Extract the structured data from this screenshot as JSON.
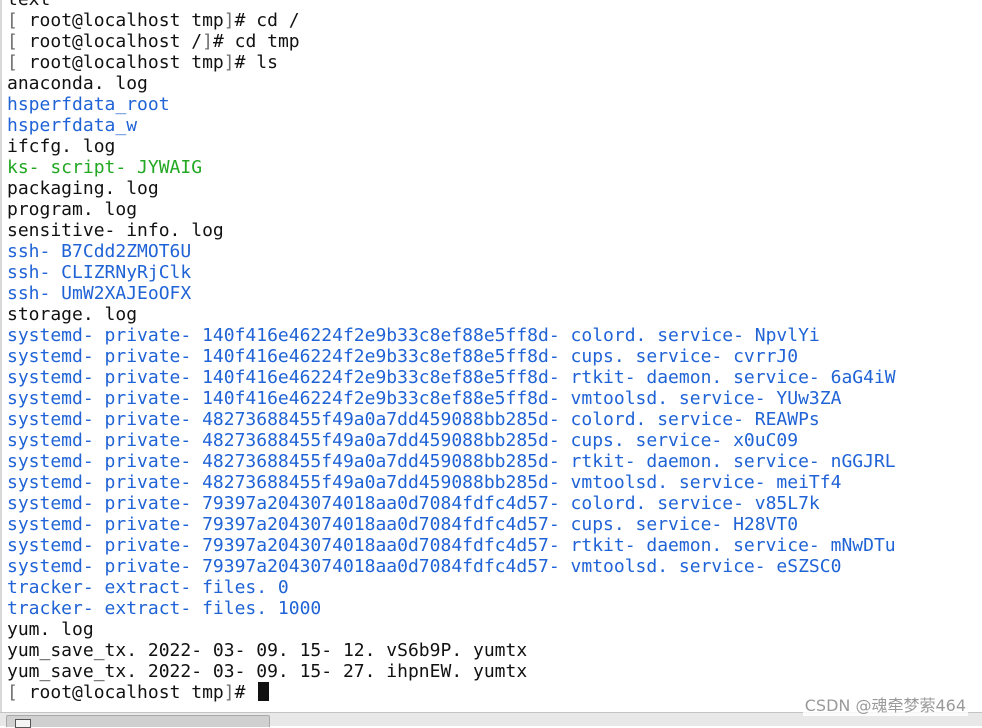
{
  "terminal": {
    "lines": [
      {
        "type": "plain",
        "text": "text"
      },
      {
        "type": "prompt",
        "user_host": "root@localhost",
        "cwd": "tmp",
        "cmd": "cd /"
      },
      {
        "type": "prompt",
        "user_host": "root@localhost",
        "cwd": "/",
        "cmd": "cd tmp"
      },
      {
        "type": "prompt",
        "user_host": "root@localhost",
        "cwd": "tmp",
        "cmd": "ls"
      },
      {
        "type": "file",
        "text": "anaconda. log"
      },
      {
        "type": "dir",
        "text": "hsperfdata_root"
      },
      {
        "type": "dir",
        "text": "hsperfdata_w"
      },
      {
        "type": "file",
        "text": "ifcfg. log"
      },
      {
        "type": "exec",
        "text": "ks- script- JYWAIG"
      },
      {
        "type": "file",
        "text": "packaging. log"
      },
      {
        "type": "file",
        "text": "program. log"
      },
      {
        "type": "file",
        "text": "sensitive- info. log"
      },
      {
        "type": "dir",
        "text": "ssh- B7Cdd2ZMOT6U"
      },
      {
        "type": "dir",
        "text": "ssh- CLIZRNyRjClk"
      },
      {
        "type": "dir",
        "text": "ssh- UmW2XAJEoOFX"
      },
      {
        "type": "file",
        "text": "storage. log"
      },
      {
        "type": "dir",
        "text": "systemd- private- 140f416e46224f2e9b33c8ef88e5ff8d- colord. service- NpvlYi"
      },
      {
        "type": "dir",
        "text": "systemd- private- 140f416e46224f2e9b33c8ef88e5ff8d- cups. service- cvrrJ0"
      },
      {
        "type": "dir",
        "text": "systemd- private- 140f416e46224f2e9b33c8ef88e5ff8d- rtkit- daemon. service- 6aG4iW"
      },
      {
        "type": "dir",
        "text": "systemd- private- 140f416e46224f2e9b33c8ef88e5ff8d- vmtoolsd. service- YUw3ZA"
      },
      {
        "type": "dir",
        "text": "systemd- private- 48273688455f49a0a7dd459088bb285d- colord. service- REAWPs"
      },
      {
        "type": "dir",
        "text": "systemd- private- 48273688455f49a0a7dd459088bb285d- cups. service- x0uC09"
      },
      {
        "type": "dir",
        "text": "systemd- private- 48273688455f49a0a7dd459088bb285d- rtkit- daemon. service- nGGJRL"
      },
      {
        "type": "dir",
        "text": "systemd- private- 48273688455f49a0a7dd459088bb285d- vmtoolsd. service- meiTf4"
      },
      {
        "type": "dir",
        "text": "systemd- private- 79397a2043074018aa0d7084fdfc4d57- colord. service- v85L7k"
      },
      {
        "type": "dir",
        "text": "systemd- private- 79397a2043074018aa0d7084fdfc4d57- cups. service- H28VT0"
      },
      {
        "type": "dir",
        "text": "systemd- private- 79397a2043074018aa0d7084fdfc4d57- rtkit- daemon. service- mNwDTu"
      },
      {
        "type": "dir",
        "text": "systemd- private- 79397a2043074018aa0d7084fdfc4d57- vmtoolsd. service- eSZSC0"
      },
      {
        "type": "dir",
        "text": "tracker- extract- files. 0"
      },
      {
        "type": "dir",
        "text": "tracker- extract- files. 1000"
      },
      {
        "type": "file",
        "text": "yum. log"
      },
      {
        "type": "file",
        "text": "yum_save_tx. 2022- 03- 09. 15- 12. vS6b9P. yumtx"
      },
      {
        "type": "file",
        "text": "yum_save_tx. 2022- 03- 09. 15- 27. ihpnEW. yumtx"
      },
      {
        "type": "prompt",
        "user_host": "root@localhost",
        "cwd": "tmp",
        "cmd": "",
        "cursor": true
      }
    ]
  },
  "watermark": "CSDN @魂牵梦萦464",
  "colors": {
    "directory": "#1f63d6",
    "executable": "#22a822",
    "text": "#111111",
    "background": "#ffffff"
  },
  "icons": {
    "cursor": "block-cursor-icon",
    "scrollbar": "horizontal-scrollbar-icon"
  }
}
